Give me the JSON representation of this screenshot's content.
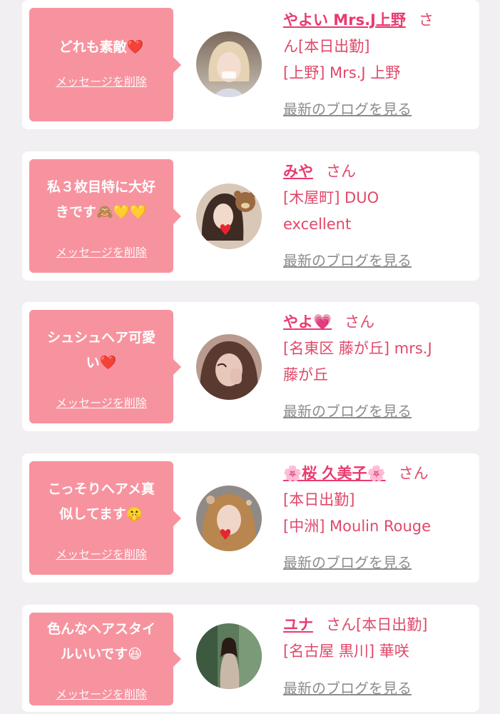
{
  "cards": [
    {
      "message_lines": [
        "どれも素敵❤️"
      ],
      "delete_label": "メッセージを削除",
      "name": "やよい Mrs.J上野",
      "honorific": "さ",
      "line2": "ん[本日出勤]",
      "line3": "[上野] Mrs.J 上野",
      "line4": "",
      "blog_label": "最新のブログを見る"
    },
    {
      "message_lines": [
        "私３枚目特に大好",
        "きです🙈💛💛"
      ],
      "delete_label": "メッセージを削除",
      "name": "みや",
      "honorific": "さん",
      "line2": "[木屋町] DUO",
      "line3": "excellent",
      "line4": "",
      "blog_label": "最新のブログを見る"
    },
    {
      "message_lines": [
        "シュシュヘア可愛",
        "い❤️"
      ],
      "delete_label": "メッセージを削除",
      "name": "やよ💗",
      "honorific": "さん",
      "line2": "[名東区 藤が丘] mrs.J",
      "line3": "藤が丘",
      "line4": "",
      "blog_label": "最新のブログを見る"
    },
    {
      "message_lines": [
        "こっそりヘアメ真",
        "似してます🤫"
      ],
      "delete_label": "メッセージを削除",
      "name": "🌸桜 久美子🌸",
      "honorific": "さん",
      "line2": "[本日出勤]",
      "line3": "[中洲] Moulin Rouge",
      "line4": "",
      "blog_label": "最新のブログを見る"
    },
    {
      "message_lines": [
        "色んなヘアスタイ",
        "ルいいです😆"
      ],
      "delete_label": "メッセージを削除",
      "name": "ユナ",
      "honorific": "さん[本日出勤]",
      "line2": "[名古屋 黒川] 華咲",
      "line3": "",
      "line4": "",
      "blog_label": "最新のブログを見る"
    }
  ],
  "colors": {
    "page_bg": "#f1eff1",
    "bubble": "#f7939f",
    "name": "#e93b6e",
    "info_text": "#e04869",
    "blog_link": "#8c8c8c"
  }
}
